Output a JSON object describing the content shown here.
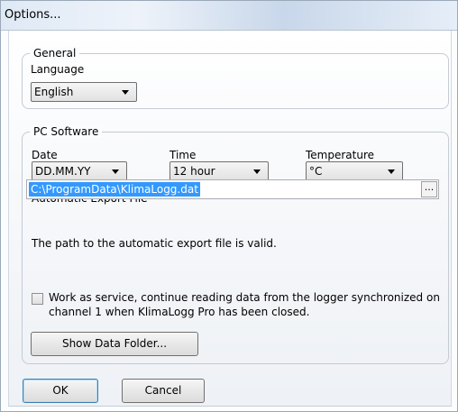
{
  "window": {
    "title": "Options..."
  },
  "general": {
    "legend": "General",
    "language_label": "Language",
    "language_value": "English"
  },
  "pc_software": {
    "legend": "PC Software",
    "date_label": "Date",
    "date_value": "DD.MM.YY",
    "time_label": "Time",
    "time_value": "12 hour",
    "temperature_label": "Temperature",
    "temperature_value": "°C",
    "export_label": "Automatic Export File",
    "export_path": "C:\\ProgramData\\KlimaLogg.dat",
    "browse_label": "...",
    "path_status": "The path to the automatic export file is valid.",
    "service_text_line1": "Work as service, continue reading data from the logger synchronized on",
    "service_text_line2": "channel 1 when KlimaLogg Pro has been closed.",
    "service_checked": false,
    "show_data_folder": "Show Data Folder..."
  },
  "buttons": {
    "ok": "OK",
    "cancel": "Cancel"
  },
  "icons": {
    "dropdown": "chevron-down-icon",
    "checkbox": "checkbox-icon"
  }
}
